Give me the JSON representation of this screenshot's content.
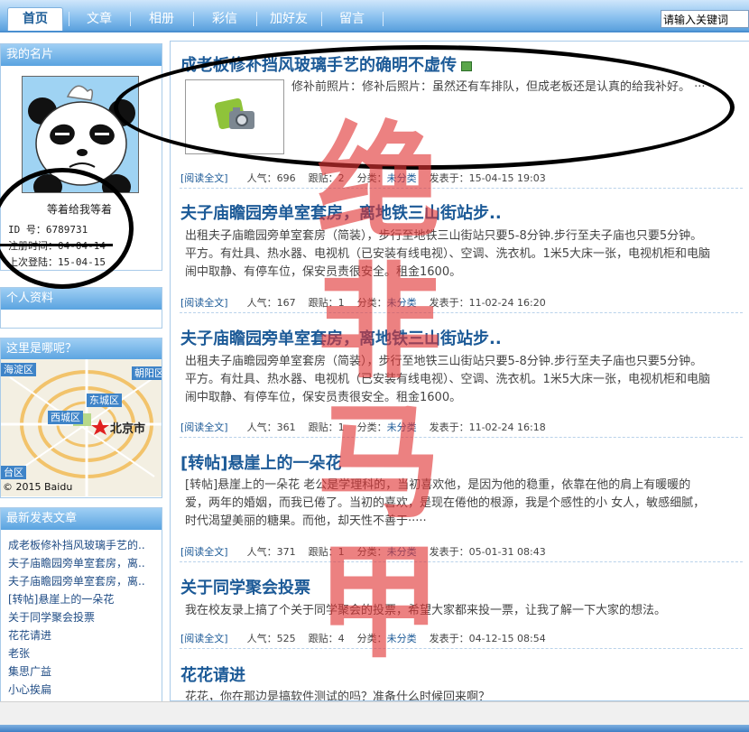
{
  "nav": {
    "tabs": [
      "首页",
      "文章",
      "相册",
      "彩信",
      "加好友",
      "留言"
    ],
    "search_value": "请输入关键词"
  },
  "sidebar": {
    "card": {
      "title": "我的名片",
      "nickname": "等着给我等着",
      "id_label": "ID    号：",
      "id_value": "6789731",
      "reg_label": "注册时间：",
      "reg_value": "04-04-14",
      "last_label": "上次登陆：",
      "last_value": "15-04-15"
    },
    "profile_title": "个人资料",
    "map": {
      "title": "这里是哪呢？",
      "labels": [
        "海淀区",
        "朝阳区",
        "东城区",
        "西城区",
        "台区"
      ],
      "city": "北京市",
      "copyright": "© 2015 Baidu"
    },
    "recent": {
      "title": "最新发表文章",
      "items": [
        "成老板修补挡风玻璃手艺的..",
        "夫子庙瞻园旁单室套房，离..",
        "夫子庙瞻园旁单室套房，离..",
        "[转帖]悬崖上的一朵花",
        "关于同学聚会投票",
        "花花请进",
        "老张",
        "集思广益",
        "小心挨扁"
      ]
    }
  },
  "meta_labels": {
    "read": "阅读全文",
    "views": "人气：",
    "replies": "跟贴：",
    "category": "分类：",
    "posted": "发表于："
  },
  "posts": [
    {
      "title": "成老板修补挡风玻璃手艺的确明不虚传",
      "excerpt": [
        "修补前照片：修补后照片：虽然还有车排队，但成老板还是认真的给我补好。 ···"
      ],
      "views": "696",
      "replies": "2",
      "category": "未分类",
      "date": "15-04-15 19:03"
    },
    {
      "title": "夫子庙瞻园旁单室套房，离地铁三山街站步..",
      "excerpt": [
        "出租夫子庙瞻园旁单室套房（简装），步行至地铁三山街站只要5-8分钟.步行至夫子庙也只要5分钟。",
        "平方。有灶具、热水器、电视机（已安装有线电视）、空调、洗衣机。1米5大床一张，电视机柜和电脑",
        "闹中取静、有停车位，保安员责很安全。租金1600。"
      ],
      "views": "167",
      "replies": "1",
      "category": "未分类",
      "date": "11-02-24 16:20"
    },
    {
      "title": "夫子庙瞻园旁单室套房，离地铁三山街站步..",
      "excerpt": [
        "出租夫子庙瞻园旁单室套房（简装），步行至地铁三山街站只要5-8分钟.步行至夫子庙也只要5分钟。",
        "平方。有灶具、热水器、电视机（已安装有线电视）、空调、洗衣机。1米5大床一张，电视机柜和电脑",
        "闹中取静、有停车位，保安员责很安全。租金1600。"
      ],
      "views": "361",
      "replies": "1",
      "category": "未分类",
      "date": "11-02-24 16:18"
    },
    {
      "title": "[转帖]悬崖上的一朵花",
      "excerpt": [
        "[转帖]悬崖上的一朵花  老公是学理科的，当初喜欢他，是因为他的稳重，依靠在他的肩上有暖暖的",
        "爱，两年的婚姻，而我已倦了。当初的喜欢，是现在倦他的根源，我是个感性的小 女人，敏感细腻，",
        "时代渴望美丽的糖果。而他，却天性不善于·····"
      ],
      "views": "371",
      "replies": "1",
      "category": "未分类",
      "date": "05-01-31 08:43"
    },
    {
      "title": "关于同学聚会投票",
      "excerpt": [
        "我在校友录上搞了个关于同学聚会的投票，希望大家都来投一票，让我了解一下大家的想法。"
      ],
      "views": "525",
      "replies": "4",
      "category": "未分类",
      "date": "04-12-15 08:54"
    },
    {
      "title": "花花请进",
      "excerpt": [
        "花花，你在那边是搞软件测试的吗？准备什么时候回来啊？"
      ]
    }
  ],
  "watermark": "绝非马甲",
  "colors": {
    "nav_bar": "#5aa0dd",
    "title_link": "#1c5a97",
    "watermark": "#e13434",
    "panel_border": "#a9cbe9"
  }
}
